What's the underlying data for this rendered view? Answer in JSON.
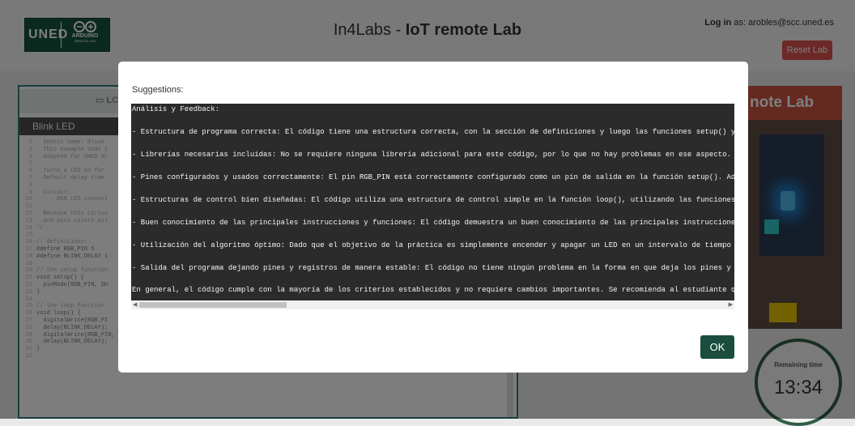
{
  "header": {
    "logo_uned": "UNED",
    "logo_arduino": "ARDUINO",
    "logo_arduino_sub": "REMOTE LAB",
    "title_prefix": "In4Labs - ",
    "title_bold": "IoT remote Lab",
    "login_label": "Log in",
    "login_rest": " as: arobles@scc.uned.es",
    "reset_label": "Reset Lab"
  },
  "background": {
    "lcd_tab": "LC",
    "sketch_title": "Blink LED",
    "code_lines": [
      {
        "n": "2",
        "t": "  Sketch name: Blink",
        "c": true
      },
      {
        "n": "3",
        "t": "  This example code i",
        "c": true
      },
      {
        "n": "4",
        "t": "  Adapted for UNED Ar",
        "c": true
      },
      {
        "n": "5",
        "t": "",
        "c": false
      },
      {
        "n": "6",
        "t": "  Turns a LED on for",
        "c": true
      },
      {
        "n": "7",
        "t": "  Default delay time",
        "c": true
      },
      {
        "n": "8",
        "t": "",
        "c": false
      },
      {
        "n": "9",
        "t": "  Circuit:",
        "c": true
      },
      {
        "n": "10",
        "t": "    - RGB LED connect",
        "c": true
      },
      {
        "n": "11",
        "t": "",
        "c": false
      },
      {
        "n": "12",
        "t": "  Because this circui",
        "c": true
      },
      {
        "n": "13",
        "t": "  and pins colors wil",
        "c": true
      },
      {
        "n": "14",
        "t": "*/",
        "c": true
      },
      {
        "n": "15",
        "t": "",
        "c": false
      },
      {
        "n": "16",
        "t": "// definitions:",
        "c": true
      },
      {
        "n": "17",
        "t": "#define RGB_PIN 5",
        "c": false
      },
      {
        "n": "18",
        "t": "#define BLINK_DELAY 1",
        "c": false
      },
      {
        "n": "19",
        "t": "",
        "c": false
      },
      {
        "n": "20",
        "t": "// the setup function",
        "c": true
      },
      {
        "n": "21",
        "t": "void setup() {",
        "c": false
      },
      {
        "n": "22",
        "t": "  pinMode(RGB_PIN, OU",
        "c": false
      },
      {
        "n": "23",
        "t": "}",
        "c": false
      },
      {
        "n": "24",
        "t": "",
        "c": false
      },
      {
        "n": "25",
        "t": "// the loop function",
        "c": true
      },
      {
        "n": "26",
        "t": "void loop() {",
        "c": false
      },
      {
        "n": "27",
        "t": "  digitalWrite(RGB_PI",
        "c": false
      },
      {
        "n": "28",
        "t": "  delay(BLINK_DELAY);           // wait for set delay time",
        "c": false
      },
      {
        "n": "29",
        "t": "  digitalWrite(RGB_PIN, LOW);   // turn the LED off",
        "c": false
      },
      {
        "n": "30",
        "t": "  delay(BLINK_DELAY);           // wait for set delay time",
        "c": false
      },
      {
        "n": "31",
        "t": "}",
        "c": false
      },
      {
        "n": "32",
        "t": "",
        "c": false
      }
    ],
    "camera_banner": "note Lab",
    "remaining_label": "Remaining time",
    "remaining_value": "13:34"
  },
  "modal": {
    "label": "Suggestions:",
    "lines": [
      "Análisis y Feedback:",
      "",
      "- Estructura de programa correcta: El código tiene una estructura correcta, con la sección de definiciones y luego las funciones setup() y lo",
      "",
      "- Librerías necesarias incluidas: No se requiere ninguna librería adicional para este código, por lo que no hay problemas en ese aspecto.",
      "",
      "- Pines configurados y usados correctamente: El pin RGB_PIN está correctamente configurado como un pin de salida en la función setup(). Además",
      "",
      "- Estructuras de control bien diseñadas: El código utiliza una estructura de control simple en la función loop(), utilizando las funciones di",
      "",
      "- Buen conocimiento de las principales instrucciones y funciones: El código demuestra un buen conocimiento de las principales instrucciones y",
      "",
      "- Utilización del algoritmo óptimo: Dado que el objetivo de la práctica es simplemente encender y apagar un LED en un intervalo de tiempo esp",
      "",
      "- Salida del programa dejando pines y registros de manera estable: El código no tiene ningún problema en la forma en que deja los pines y reg",
      "",
      "En general, el código cumple con la mayoría de los criterios establecidos y no requiere cambios importantes. Se recomienda al estudiante que"
    ],
    "ok_label": "OK"
  }
}
